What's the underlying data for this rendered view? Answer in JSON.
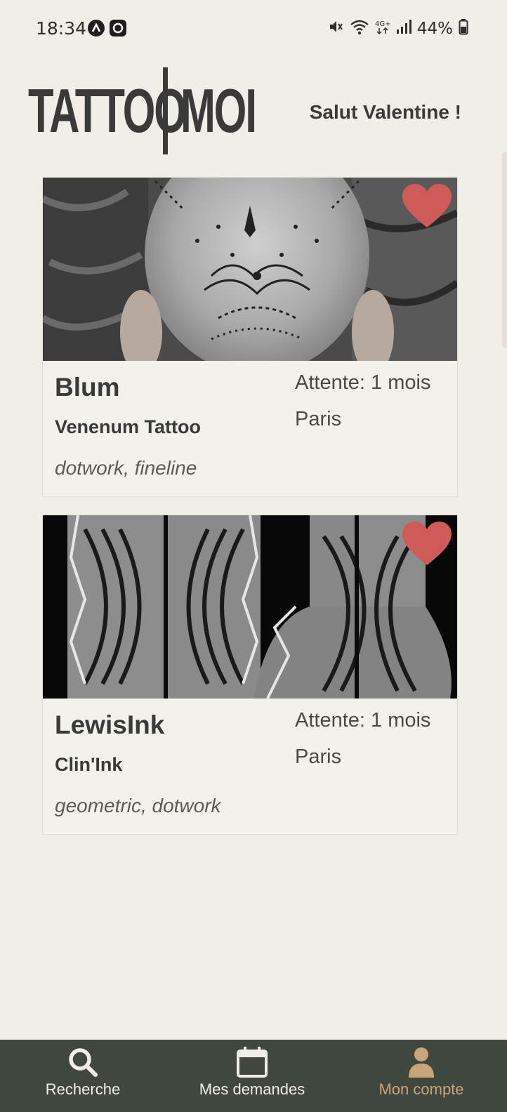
{
  "status_bar": {
    "time": "18:34",
    "battery": "44%",
    "icons": [
      "mute-icon",
      "wifi-icon",
      "4g-icon",
      "signal-icon",
      "battery-icon"
    ]
  },
  "header": {
    "logo_left": "TATTOO",
    "logo_right": "MOI",
    "greeting": "Salut Valentine !"
  },
  "cards": [
    {
      "artist": "Blum",
      "studio": "Venenum Tattoo",
      "styles": "dotwork, fineline",
      "wait": "Attente: 1 mois",
      "city": "Paris",
      "favorite": true,
      "image_icon": "tattoo-photo-head"
    },
    {
      "artist": "LewisInk",
      "studio": "Clin'Ink",
      "styles": "geometric, dotwork",
      "wait": "Attente: 1 mois",
      "city": "Paris",
      "favorite": true,
      "image_icon": "tattoo-photo-geometric"
    }
  ],
  "nav": {
    "items": [
      {
        "label": "Recherche",
        "icon": "search-icon",
        "active": false
      },
      {
        "label": "Mes demandes",
        "icon": "calendar-icon",
        "active": false
      },
      {
        "label": "Mon compte",
        "icon": "user-icon",
        "active": true
      }
    ]
  },
  "colors": {
    "background": "#f1eee7",
    "nav_bg": "#3f473f",
    "accent": "#c8a577",
    "heart": "#cf5a5a",
    "text": "#3a3a38"
  }
}
